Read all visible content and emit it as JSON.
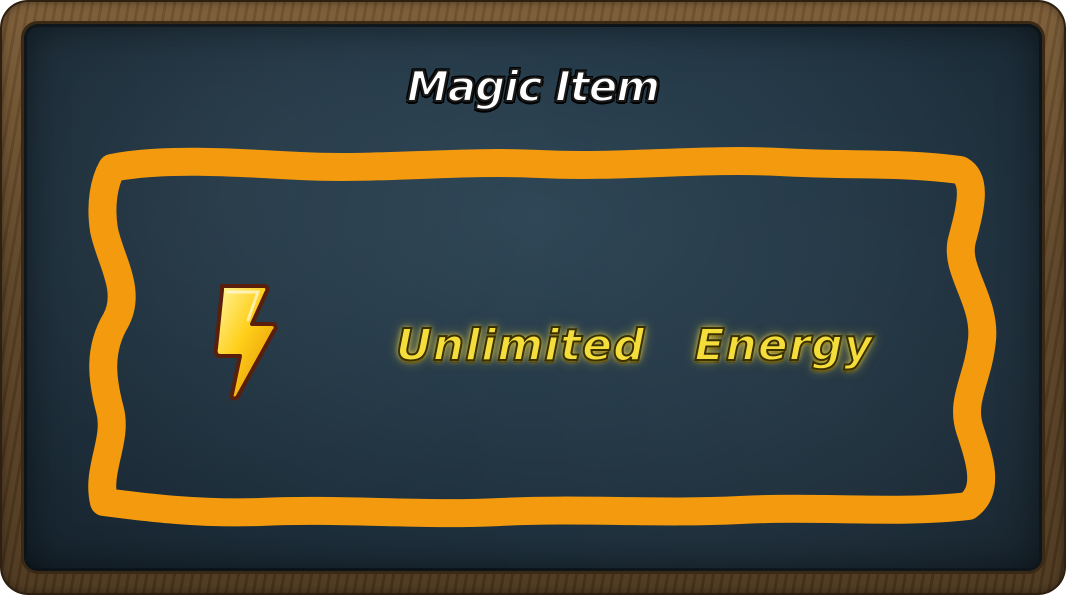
{
  "dialog": {
    "title": "Magic Item",
    "item": {
      "icon": "lightning-bolt-icon",
      "label": "Unlimited   Energy"
    }
  },
  "colors": {
    "frame_wood": "#5c4325",
    "board": "#233745",
    "outline_orange": "#f39a0e",
    "title_text": "#ffffff",
    "label_text": "#f5dd3c"
  }
}
